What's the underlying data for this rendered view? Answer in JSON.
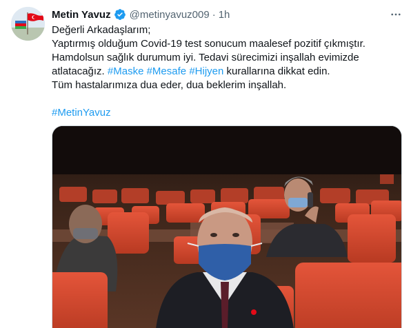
{
  "author": {
    "name": "Metin Yavuz",
    "handle": "@metinyavuz009",
    "separator": "·",
    "time": "1h",
    "avatar_icon": "flag-avatar-icon",
    "verified_icon": "verified-badge-icon",
    "more_icon": "more-options-icon"
  },
  "tweet": {
    "line1": "Değerli Arkadaşlarım;",
    "line2": "Yaptırmış olduğum Covid-19 test sonucum maalesef pozitif çıkmıştır.",
    "line3": "Hamdolsun sağlık durumum iyi. Tedavi sürecimizi inşallah evimizde",
    "line4_prefix": "atlatacağız. ",
    "tag1": "#Maske",
    "tag2": "#Mesafe",
    "tag3": "#Hijyen",
    "line4_suffix": " kurallarına dikkat edin.",
    "line5": "Tüm hastalarımıza dua eder, dua beklerim inşallah.",
    "hashtag": "#MetinYavuz"
  },
  "colors": {
    "link": "#1d9bf0",
    "text": "#0f1419",
    "muted": "#536471",
    "verified": "#1d9bf0",
    "seat": "#d9482a",
    "mask": "#2f5fa8"
  }
}
